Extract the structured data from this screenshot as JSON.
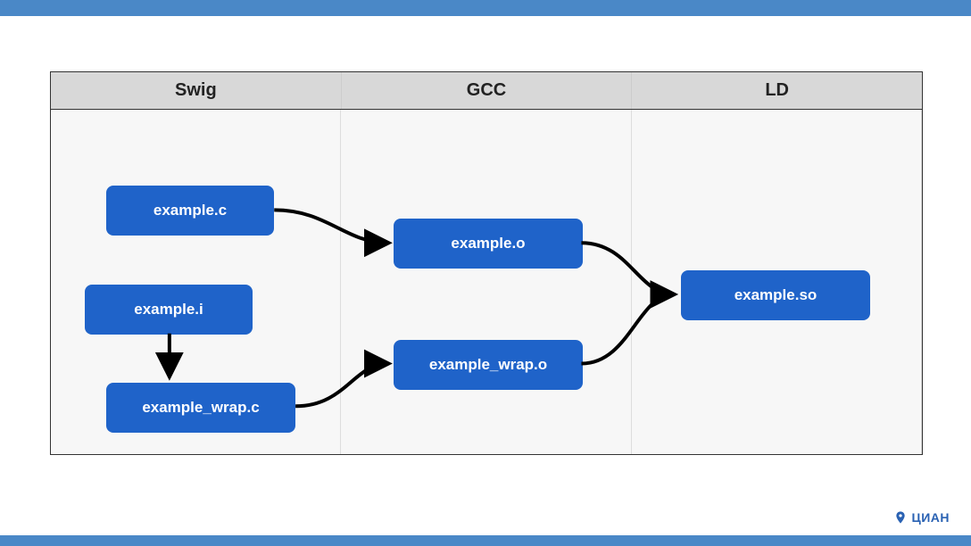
{
  "columns": {
    "swig": "Swig",
    "gcc": "GCC",
    "ld": "LD"
  },
  "nodes": {
    "example_c": "example.c",
    "example_i": "example.i",
    "example_wrap_c": "example_wrap.c",
    "example_o": "example.o",
    "example_wrap_o": "example_wrap.o",
    "example_so": "example.so"
  },
  "edges": [
    {
      "from": "example_i",
      "to": "example_wrap_c"
    },
    {
      "from": "example_c",
      "to": "example_o"
    },
    {
      "from": "example_wrap_c",
      "to": "example_wrap_o"
    },
    {
      "from": "example_o",
      "to": "example_so"
    },
    {
      "from": "example_wrap_o",
      "to": "example_so"
    }
  ],
  "logo_text": "ЦИАН"
}
